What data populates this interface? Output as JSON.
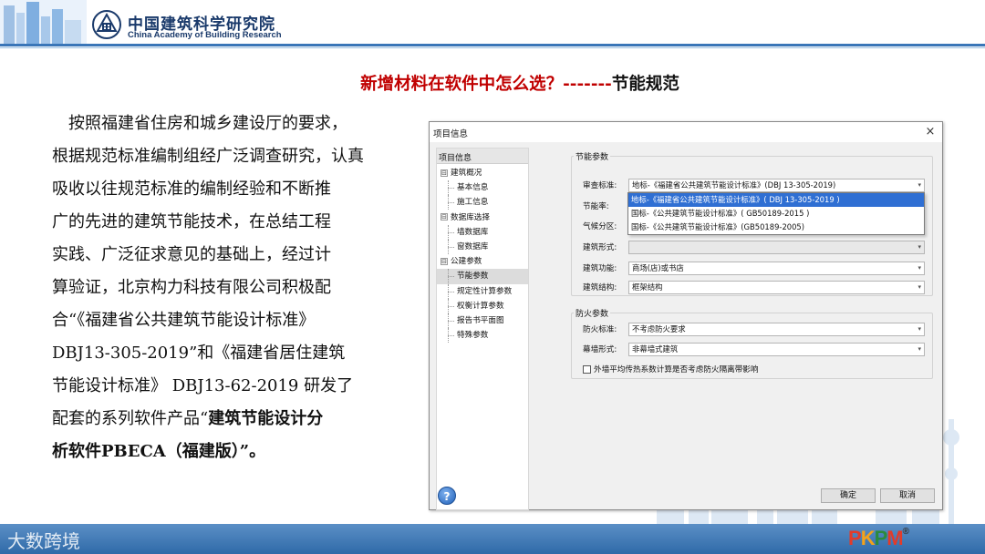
{
  "header": {
    "org_cn": "中国建筑科学研究院",
    "org_en": "China Academy of Building Research",
    "brand_color": "#3a76b8"
  },
  "slide": {
    "title_red": "新增材料在软件中怎么选？-------",
    "title_black": "节能规范",
    "title_color": "#c00000",
    "body": {
      "line1": "按照福建省住房和城乡建设厅的要求，",
      "line2": "根据规范标准编制组经广泛调查研究，认真",
      "line3": "吸收以往规范标准的编制经验和不断推",
      "line4": "广的先进的建筑节能技术，在总结工程",
      "line5": "实践、广泛征求意见的基础上，经过计",
      "line6": "算验证，北京构力科技有限公司积极配",
      "line7": "合“《福建省公共建筑节能设计标准》",
      "line8": "DBJ13-305-2019”和《福建省居住建筑",
      "line9": "节能设计标准》 DBJ13-62-2019 研发了",
      "line10_pre": "配套的系列软件产品“",
      "line10_bold": "建筑节能设计分",
      "line11_bold": "析软件PBECA（福建版）”",
      "line11_post": "。"
    }
  },
  "dialog": {
    "title": "项目信息",
    "close_glyph": "×",
    "tree": {
      "header": "项目信息",
      "items": [
        {
          "label": "建筑概况",
          "level": 0,
          "expander": "⊟"
        },
        {
          "label": "基本信息",
          "level": 1
        },
        {
          "label": "施工信息",
          "level": 1
        },
        {
          "label": "数据库选择",
          "level": 0,
          "expander": "⊟"
        },
        {
          "label": "墙数据库",
          "level": 1
        },
        {
          "label": "窗数据库",
          "level": 1
        },
        {
          "label": "公建参数",
          "level": 0,
          "expander": "⊟"
        },
        {
          "label": "节能参数",
          "level": 1,
          "selected": true
        },
        {
          "label": "规定性计算参数",
          "level": 1
        },
        {
          "label": "权衡计算参数",
          "level": 1
        },
        {
          "label": "报告书平面图",
          "level": 1
        },
        {
          "label": "特殊参数",
          "level": 1
        }
      ]
    },
    "energy_group": {
      "title": "节能参数",
      "review_standard_label": "审查标准:",
      "review_standard_value": "地标-《福建省公共建筑节能设计标准》(DBJ 13-305-2019)",
      "energy_rate_label": "节能率:",
      "climate_zone_label": "气候分区:",
      "building_form_label": "建筑形式:",
      "building_form_value": "",
      "building_function_label": "建筑功能:",
      "building_function_value": "商场(店)或书店",
      "building_structure_label": "建筑结构:",
      "building_structure_value": "框架结构",
      "dropdown_options": [
        "地标-《福建省公共建筑节能设计标准》( DBJ 13-305-2019 )",
        "国标-《公共建筑节能设计标准》( GB50189-2015 )",
        "国标-《公共建筑节能设计标准》(GB50189-2005)"
      ],
      "dropdown_highlight_color": "#2f6fd3"
    },
    "fire_group": {
      "title": "防火参数",
      "fire_standard_label": "防火标准:",
      "fire_standard_value": "不考虑防火要求",
      "curtain_wall_label": "幕墙形式:",
      "curtain_wall_value": "非幕墙式建筑",
      "checkbox_label": "外墙平均传热系数计算是否考虑防火隔离带影响",
      "checkbox_checked": false
    },
    "buttons": {
      "ok": "确定",
      "cancel": "取消",
      "help": "?"
    }
  },
  "footer": {
    "watermark": "大数跨境",
    "brand": {
      "p1": "P",
      "k": "K",
      "p2": "P",
      "m": "M",
      "reg": "®"
    }
  }
}
